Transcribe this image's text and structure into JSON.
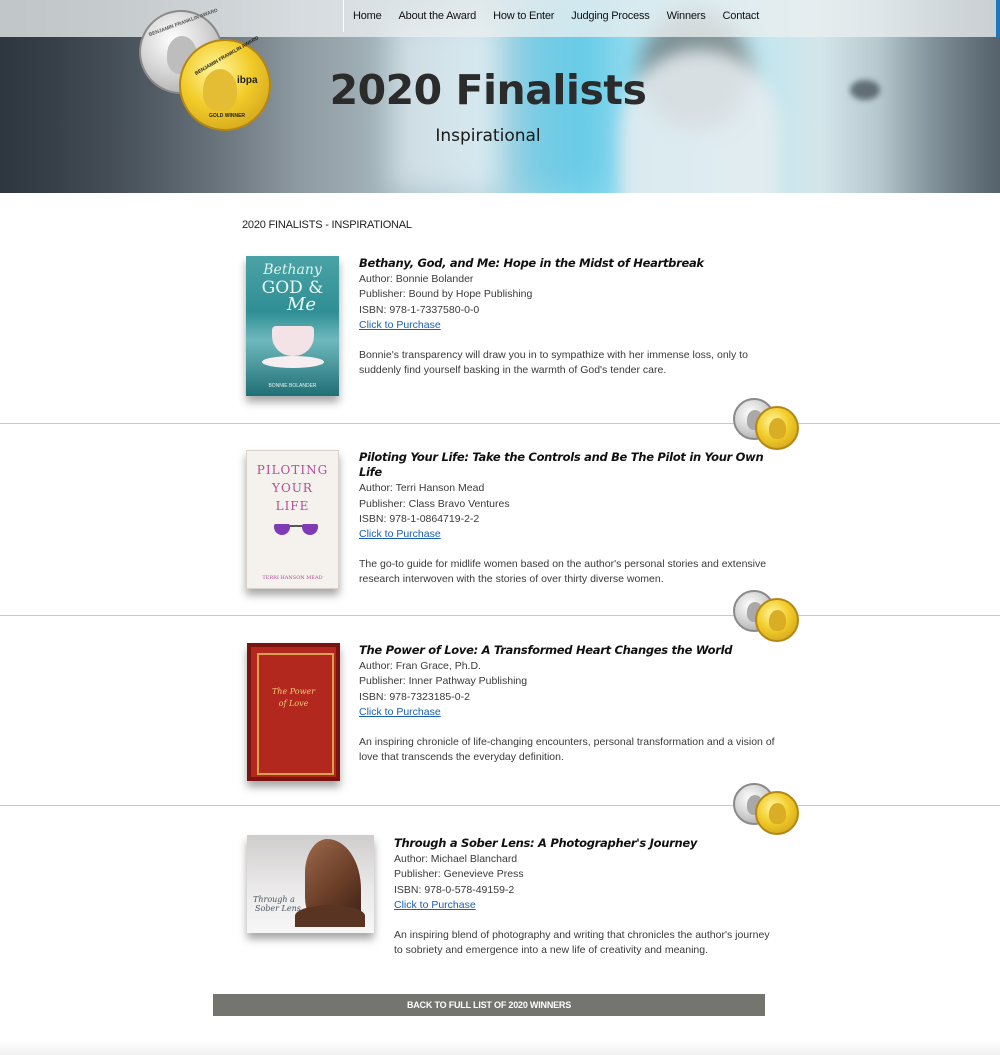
{
  "nav": {
    "items": [
      "Home",
      "About the Award",
      "How to Enter",
      "Judging Process",
      "Winners",
      "Contact"
    ]
  },
  "hero": {
    "title": "2020 Finalists",
    "subtitle": "Inspirational"
  },
  "logo": {
    "silver_text": "BENJAMIN FRANKLIN AWARD",
    "gold_text": "BENJAMIN FRANKLIN AWARD",
    "gold_brand": "ibpa",
    "gold_sub": "GOLD WINNER"
  },
  "section": {
    "label": "2020 FINALISTS - INSPIRATIONAL"
  },
  "books": [
    {
      "title": "Bethany, God, and Me: Hope in the Midst of Heartbreak",
      "author": "Author: Bonnie Bolander",
      "publisher": "Publisher: Bound by Hope Publishing",
      "isbn": "ISBN: 978-1-7337580-0-0",
      "link": "Click to Purchase",
      "description": "Bonnie's transparency will draw you in to sympathize with her immense loss, only to suddenly find yourself basking in the warmth of God's tender care.",
      "cover_lines": [
        "Bethany",
        "GOD &",
        "Me"
      ],
      "cover_author": "BONNIE BOLANDER"
    },
    {
      "title": "Piloting Your Life: Take the Controls and Be The Pilot in Your Own Life",
      "author": "Author: Terri Hanson Mead",
      "publisher": "Publisher: Class Bravo Ventures",
      "isbn": "ISBN: 978-1-0864719-2-2",
      "link": "Click to Purchase",
      "description": "The go-to guide for midlife women based on the author's personal stories and extensive research interwoven with the stories of over thirty diverse women.",
      "cover_lines": [
        "PILOTING",
        "YOUR",
        "LIFE"
      ],
      "cover_author": "TERRI HANSON MEAD"
    },
    {
      "title": "The Power of Love: A Transformed Heart Changes the World",
      "author": "Author: Fran Grace, Ph.D.",
      "publisher": "Publisher: Inner Pathway Publishing",
      "isbn": "ISBN: 978-7323185-0-2",
      "link": "Click to Purchase",
      "description": "An inspiring chronicle of life-changing encounters, personal transformation and a vision of love that transcends the everyday definition.",
      "cover_lines": [
        "The Power",
        "of Love"
      ]
    },
    {
      "title": "Through a Sober Lens: A Photographer's Journey",
      "author": "Author: Michael Blanchard",
      "publisher": "Publisher: Genevieve Press",
      "isbn": "ISBN: 978-0-578-49159-2",
      "link": "Click to Purchase",
      "description": "An inspiring blend of photography and writing that chronicles the author's journey to sobriety and emergence into a new life of creativity and meaning.",
      "cover_lines": [
        "Through a",
        "Sober Lens"
      ]
    }
  ],
  "back_button": "BACK TO FULL LIST OF 2020 WINNERS",
  "colors": {
    "link": "#1a5fae",
    "nav_accent": "#1a78c2",
    "back_bar": "#75756f",
    "gold": "#f2cc29",
    "silver": "#d7d7d7"
  }
}
